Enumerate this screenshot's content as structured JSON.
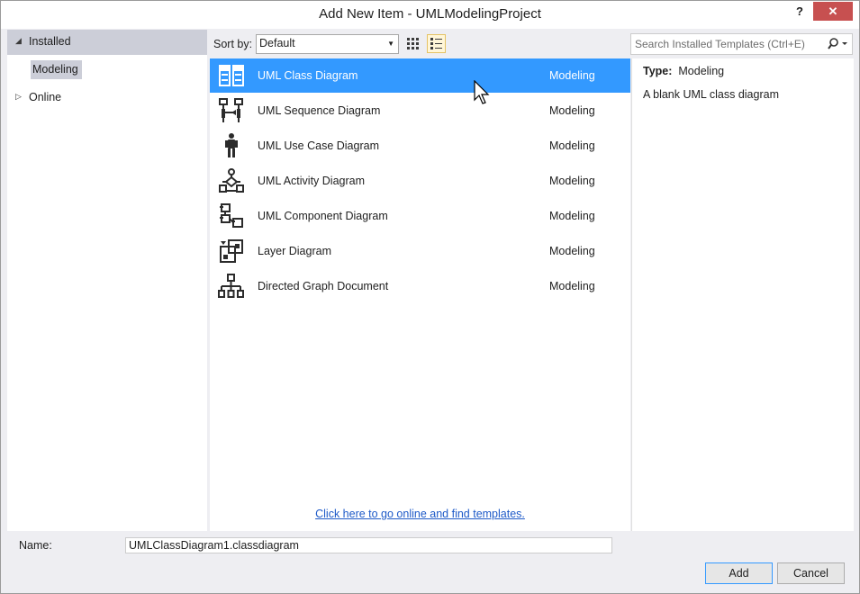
{
  "window": {
    "title": "Add New Item - UMLModelingProject",
    "help_label": "?",
    "close_label": "✕"
  },
  "tree": {
    "installed": "Installed",
    "modeling": "Modeling",
    "online": "Online"
  },
  "toolbar": {
    "sort_label": "Sort by:",
    "sort_value": "Default"
  },
  "search": {
    "placeholder": "Search Installed Templates (Ctrl+E)"
  },
  "templates": [
    {
      "name": "UML Class Diagram",
      "category": "Modeling",
      "icon": "uml-class-diagram-icon",
      "selected": true
    },
    {
      "name": "UML Sequence Diagram",
      "category": "Modeling",
      "icon": "uml-sequence-diagram-icon"
    },
    {
      "name": "UML Use Case Diagram",
      "category": "Modeling",
      "icon": "uml-use-case-diagram-icon"
    },
    {
      "name": "UML Activity Diagram",
      "category": "Modeling",
      "icon": "uml-activity-diagram-icon"
    },
    {
      "name": "UML Component Diagram",
      "category": "Modeling",
      "icon": "uml-component-diagram-icon"
    },
    {
      "name": "Layer Diagram",
      "category": "Modeling",
      "icon": "layer-diagram-icon"
    },
    {
      "name": "Directed Graph Document",
      "category": "Modeling",
      "icon": "directed-graph-icon"
    }
  ],
  "online_link": "Click here to go online and find templates.",
  "details": {
    "type_label": "Type:",
    "type_value": "Modeling",
    "description": "A blank UML class diagram"
  },
  "footer": {
    "name_label": "Name:",
    "name_value": "UMLClassDiagram1.classdiagram",
    "add_label": "Add",
    "cancel_label": "Cancel"
  },
  "colors": {
    "selection": "#3399ff",
    "close_button": "#c75050",
    "link": "#1e5ac8"
  }
}
